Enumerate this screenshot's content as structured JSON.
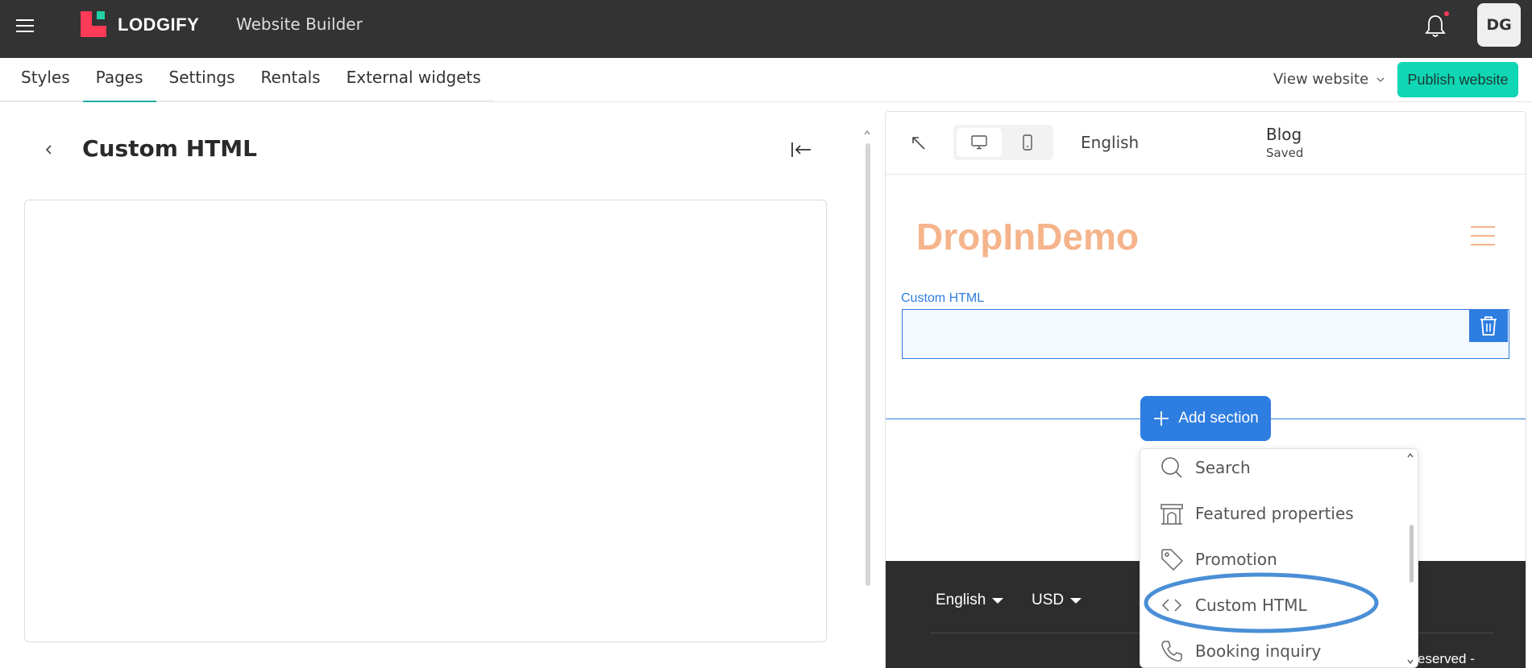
{
  "header": {
    "brand": "LODGIFY",
    "app_title": "Website Builder",
    "avatar_initials": "DG",
    "icons": [
      "menu-icon",
      "bell-icon"
    ],
    "colors": {
      "topbar": "#333333",
      "logo_red": "#ff3b57",
      "logo_green": "#1fd3a6"
    }
  },
  "nav": {
    "tabs": [
      {
        "label": "Styles"
      },
      {
        "label": "Pages",
        "active": true
      },
      {
        "label": "Settings"
      },
      {
        "label": "Rentals"
      },
      {
        "label": "External widgets"
      }
    ],
    "view_website": "View website",
    "publish": "Publish website",
    "colors": {
      "active_tab": "#1db0a2",
      "publish_bg": "#10d6b4"
    }
  },
  "left_panel": {
    "title": "Custom HTML",
    "icons": [
      "back-chevron-icon",
      "collapse-panel-icon"
    ]
  },
  "preview": {
    "language": "English",
    "page_name": "Blog",
    "save_status": "Saved",
    "site_logo": "DropInDemo",
    "section_label": "Custom HTML",
    "add_section": "Add section",
    "footer": {
      "language": "English",
      "currency": "USD",
      "copyright_fragment": "eserved -"
    },
    "colors": {
      "accent": "#2e7de0",
      "site_logo": "#f5b48b",
      "footer_bg": "#2d2d2d"
    }
  },
  "dropdown": {
    "items": [
      {
        "label": "Search",
        "icon": "search-icon"
      },
      {
        "label": "Featured properties",
        "icon": "building-icon"
      },
      {
        "label": "Promotion",
        "icon": "tag-icon"
      },
      {
        "label": "Custom HTML",
        "icon": "code-icon",
        "highlighted": true
      },
      {
        "label": "Booking inquiry",
        "icon": "phone-icon"
      }
    ],
    "highlight_color": "#4a8fd6"
  }
}
